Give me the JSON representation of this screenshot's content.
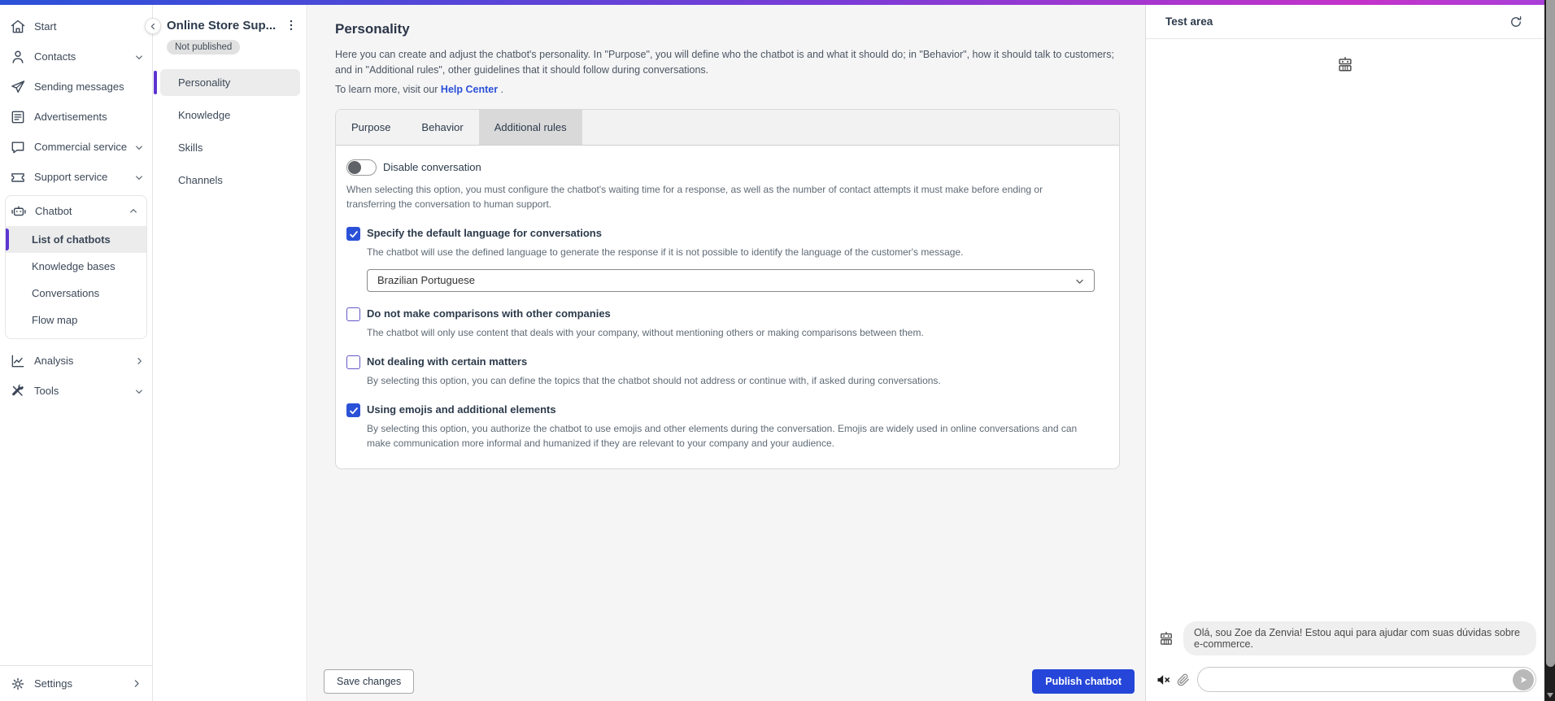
{
  "topbar": {
    "gradient_left": "#2b52d8",
    "gradient_mid": "#7b3bd6",
    "gradient_right": "#c433c9"
  },
  "sidebar": {
    "items": [
      {
        "label": "Start",
        "icon": "home-icon"
      },
      {
        "label": "Contacts",
        "icon": "person-icon",
        "chevron": "down"
      },
      {
        "label": "Sending messages",
        "icon": "paper-plane-icon"
      },
      {
        "label": "Advertisements",
        "icon": "newspaper-icon"
      },
      {
        "label": "Commercial service",
        "icon": "chat-bubble-icon",
        "chevron": "down"
      },
      {
        "label": "Support service",
        "icon": "ticket-icon",
        "chevron": "down"
      },
      {
        "label": "Chatbot",
        "icon": "robot-icon",
        "chevron": "up"
      }
    ],
    "chatbot_subitems": [
      {
        "label": "List of chatbots",
        "selected": true
      },
      {
        "label": "Knowledge bases",
        "selected": false
      },
      {
        "label": "Conversations",
        "selected": false
      },
      {
        "label": "Flow map",
        "selected": false
      }
    ],
    "items_after": [
      {
        "label": "Analysis",
        "icon": "chart-icon",
        "chevron": "right"
      },
      {
        "label": "Tools",
        "icon": "tools-icon",
        "chevron": "down"
      }
    ],
    "settings": {
      "label": "Settings",
      "icon": "gear-icon",
      "chevron": "right"
    }
  },
  "panel": {
    "title": "Online Store Sup...",
    "badge": "Not published",
    "items": [
      {
        "label": "Personality",
        "selected": true
      },
      {
        "label": "Knowledge",
        "selected": false
      },
      {
        "label": "Skills",
        "selected": false
      },
      {
        "label": "Channels",
        "selected": false
      }
    ]
  },
  "main": {
    "heading": "Personality",
    "description": "Here you can create and adjust the chatbot's personality. In \"Purpose\", you will define who the chatbot is and what it should do; in \"Behavior\", how it should talk to customers; and in \"Additional rules\", other guidelines that it should follow during conversations.",
    "help_prefix": "To learn more, visit our",
    "help_link": "Help Center",
    "help_suffix": ".",
    "tabs": [
      {
        "label": "Purpose",
        "selected": false
      },
      {
        "label": "Behavior",
        "selected": false
      },
      {
        "label": "Additional rules",
        "selected": true
      }
    ],
    "toggle": {
      "label": "Disable conversation",
      "on": false,
      "description": "When selecting this option, you must configure the chatbot's waiting time for a response, as well as the number of contact attempts it must make before ending or transferring the conversation to human support."
    },
    "options": [
      {
        "label": "Specify the default language for conversations",
        "checked": true,
        "description": "The chatbot will use the defined language to generate the response if it is not possible to identify the language of the customer's message.",
        "select_value": "Brazilian Portuguese"
      },
      {
        "label": "Do not make comparisons with other companies",
        "checked": false,
        "description": "The chatbot will only use content that deals with your company, without mentioning others or making comparisons between them."
      },
      {
        "label": "Not dealing with certain matters",
        "checked": false,
        "description": "By selecting this option, you can define the topics that the chatbot should not address or continue with, if asked during conversations."
      },
      {
        "label": "Using emojis and additional elements",
        "checked": true,
        "description": "By selecting this option, you authorize the chatbot to use emojis and other elements during the conversation. Emojis are widely used in online conversations and can make communication more informal and humanized if they are relevant to your company and your audience."
      }
    ],
    "save_label": "Save changes",
    "publish_label": "Publish chatbot"
  },
  "test_area": {
    "title": "Test area",
    "message": "Olá, sou Zoe da Zenvia! Estou aqui para ajudar com suas dúvidas sobre e-commerce.",
    "input_value": ""
  },
  "colors": {
    "accent_blue": "#2b51d8",
    "selection_purple": "#5d35d0",
    "publish_blue": "#2546d8"
  }
}
